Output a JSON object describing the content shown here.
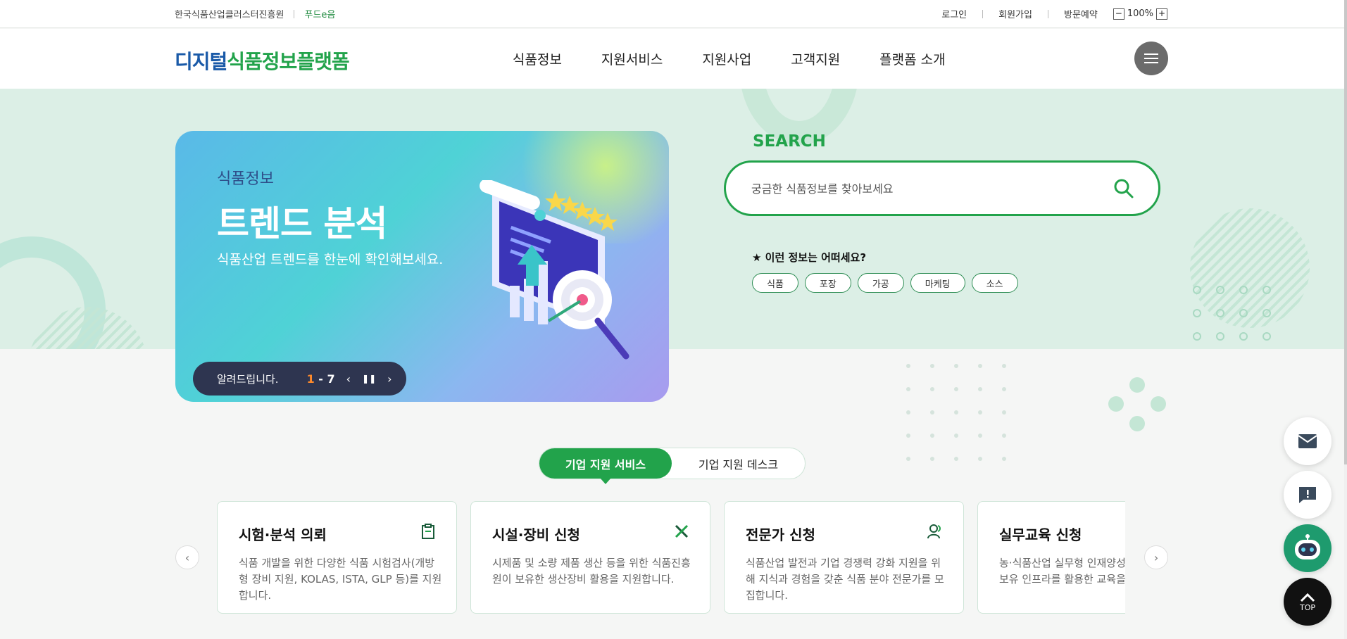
{
  "topbar": {
    "org": "한국식품산업클러스터진흥원",
    "foode": "푸드e음",
    "login": "로그인",
    "signup": "회원가입",
    "visit": "방문예약",
    "zoom_minus": "−",
    "zoom_level": "100%",
    "zoom_plus": "+"
  },
  "header": {
    "logo_part1": "디지털",
    "logo_part2": "식품정보플랫폼",
    "nav": [
      "식품정보",
      "지원서비스",
      "지원사업",
      "고객지원",
      "플랫폼 소개"
    ]
  },
  "hero": {
    "subtitle": "식품정보",
    "title": "트렌드 분석",
    "description": "식품산업 트렌드를 한눈에 확인해보세요.",
    "notice_label": "알려드립니다.",
    "page_current": "1",
    "page_sep": " - ",
    "page_total": "7"
  },
  "search": {
    "title": "SEARCH",
    "placeholder": "궁금한 식품정보를 찾아보세요",
    "recommend_label": "★ 이런 정보는 어떠세요?",
    "tags": [
      "식품",
      "포장",
      "가공",
      "마케팅",
      "소스"
    ]
  },
  "tabs": {
    "active": "기업 지원 서비스",
    "inactive": "기업 지원 데스크"
  },
  "cards": [
    {
      "title": "시험·분석 의뢰",
      "desc": "식품 개발을 위한 다양한 식품 시험검사(개방형 장비 지원, KOLAS, ISTA, GLP 등)를 지원합니다.",
      "icon": "clipboard-icon"
    },
    {
      "title": "시설·장비 신청",
      "desc": "시제품 및 소량 제품 생산 등을 위한 식품진흥원이 보유한 생산장비 활용을 지원합니다.",
      "icon": "tools-icon"
    },
    {
      "title": "전문가 신청",
      "desc": "식품산업 발전과 기업 경쟁력 강화 지원을 위해 지식과 경험을 갖춘 식품 분야 전문가를 모집합니다.",
      "icon": "users-icon"
    },
    {
      "title": "실무교육 신청",
      "desc": "농·식품산업 실무형 인재양성을 위해 진흥원 보유 인프라를 활용한 교육을 지원합니다.",
      "icon": "book-icon"
    }
  ],
  "floating": {
    "top_label": "TOP"
  },
  "colors": {
    "brand_green": "#22a34b",
    "brand_blue": "#1a5aa8",
    "hero_bg": "#dcefe6",
    "notice_bar": "#2e3550"
  }
}
